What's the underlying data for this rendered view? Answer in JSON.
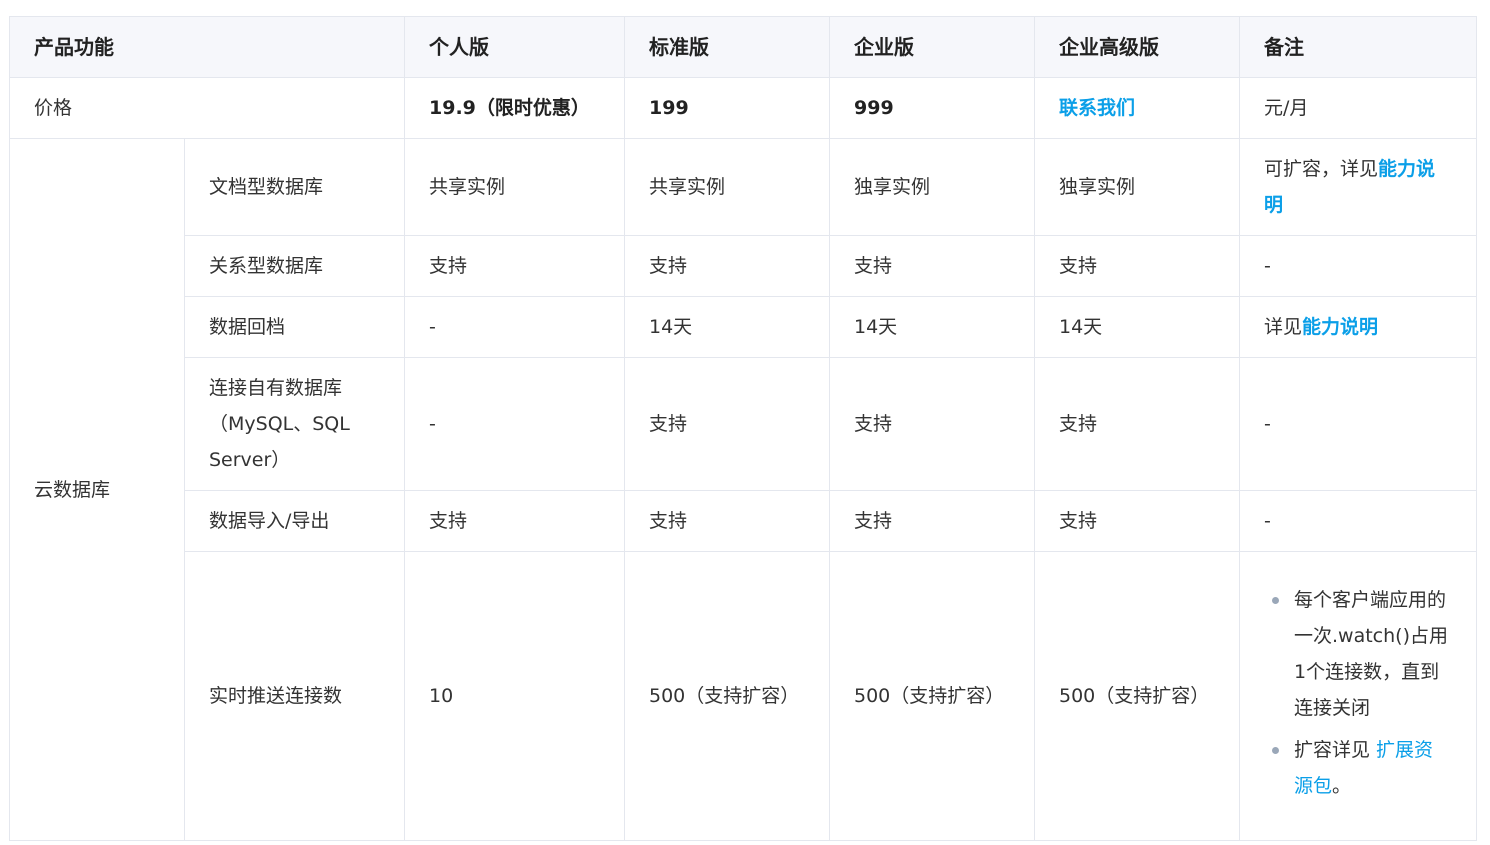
{
  "header": {
    "feature": "产品功能",
    "personal": "个人版",
    "standard": "标准版",
    "enterprise": "企业版",
    "enterprise_plus": "企业高级版",
    "notes": "备注"
  },
  "price_row": {
    "label": "价格",
    "personal": "19.9（限时优惠）",
    "standard": "199",
    "enterprise": "999",
    "enterprise_plus": "联系我们",
    "notes": "元/月"
  },
  "group": "云数据库",
  "rows": {
    "doc_db": {
      "name": "文档型数据库",
      "personal": "共享实例",
      "standard": "共享实例",
      "enterprise": "独享实例",
      "enterprise_plus": "独享实例",
      "notes_prefix": "可扩容，详见",
      "notes_link": "能力说明"
    },
    "rel_db": {
      "name": "关系型数据库",
      "personal": "支持",
      "standard": "支持",
      "enterprise": "支持",
      "enterprise_plus": "支持",
      "notes": "-"
    },
    "rollback": {
      "name": "数据回档",
      "personal": "-",
      "standard": "14天",
      "enterprise": "14天",
      "enterprise_plus": "14天",
      "notes_prefix": "详见",
      "notes_link": "能力说明"
    },
    "own_db": {
      "name": "连接自有数据库（MySQL、SQL Server）",
      "personal": "-",
      "standard": "支持",
      "enterprise": "支持",
      "enterprise_plus": "支持",
      "notes": "-"
    },
    "import_export": {
      "name": "数据导入/导出",
      "personal": "支持",
      "standard": "支持",
      "enterprise": "支持",
      "enterprise_plus": "支持",
      "notes": "-"
    },
    "realtime": {
      "name": "实时推送连接数",
      "personal": "10",
      "standard": "500（支持扩容）",
      "enterprise": "500（支持扩容）",
      "enterprise_plus": "500（支持扩容）",
      "note1": "每个客户端应用的一次.watch()占用1个连接数，直到连接关闭",
      "note2_prefix": "扩容详见 ",
      "note2_link": "扩展资源包",
      "note2_suffix": "。"
    }
  },
  "colors": {
    "link": "#0b9fe8",
    "header_bg": "#f6f7fb",
    "border": "#e4e7ee"
  }
}
